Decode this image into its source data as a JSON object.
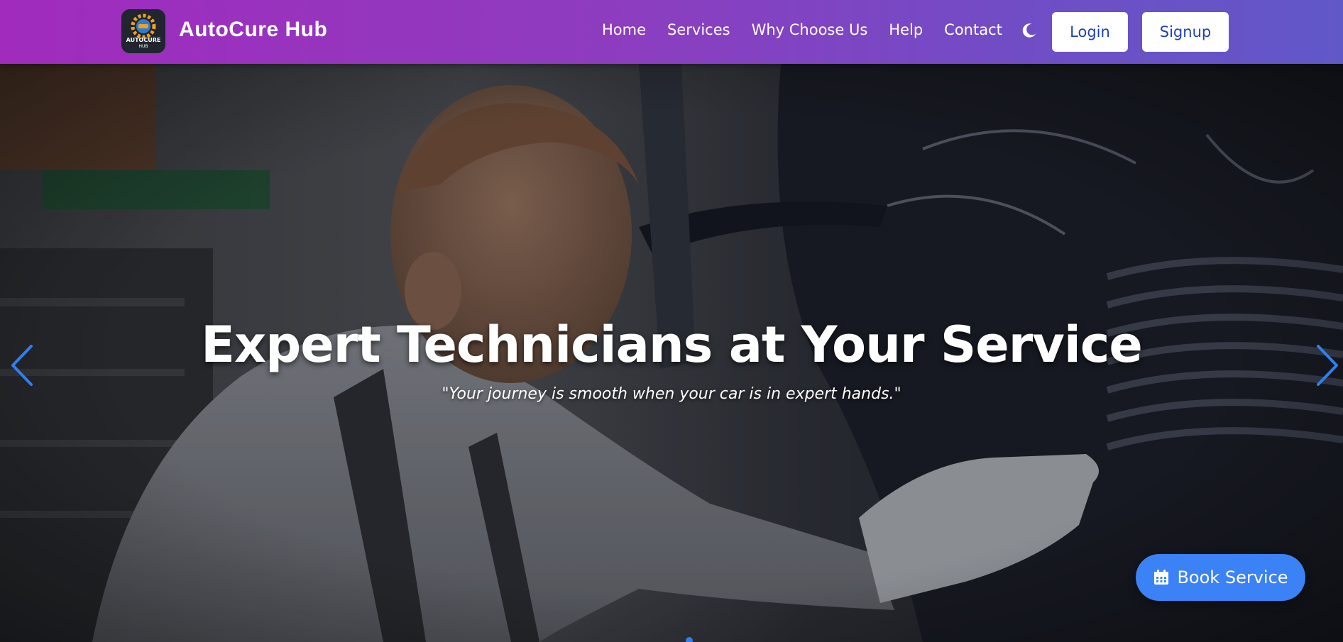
{
  "header": {
    "brand": "AutoCure Hub",
    "logo": {
      "icon": "gear-car-logo",
      "text": "AUTOCURE",
      "subtext": "HUB"
    },
    "nav": [
      {
        "label": "Home"
      },
      {
        "label": "Services"
      },
      {
        "label": "Why Choose Us"
      },
      {
        "label": "Help"
      },
      {
        "label": "Contact"
      }
    ],
    "theme_toggle_icon": "moon-icon",
    "login_label": "Login",
    "signup_label": "Signup"
  },
  "hero": {
    "title": "Expert Technicians at Your Service",
    "subtitle": "\"Your journey is smooth when your car is in expert hands.\"",
    "prev_icon": "chevron-left-icon",
    "next_icon": "chevron-right-icon",
    "image": "technician-working-on-engine"
  },
  "cta": {
    "label": "Book Service",
    "icon": "calendar-icon"
  },
  "colors": {
    "nav_gradient_start": "#a12bbd",
    "nav_gradient_end": "#6158c8",
    "button_text": "#1d3fbf",
    "cta_bg": "#3a82f6",
    "arrow": "#2f7ff0"
  }
}
